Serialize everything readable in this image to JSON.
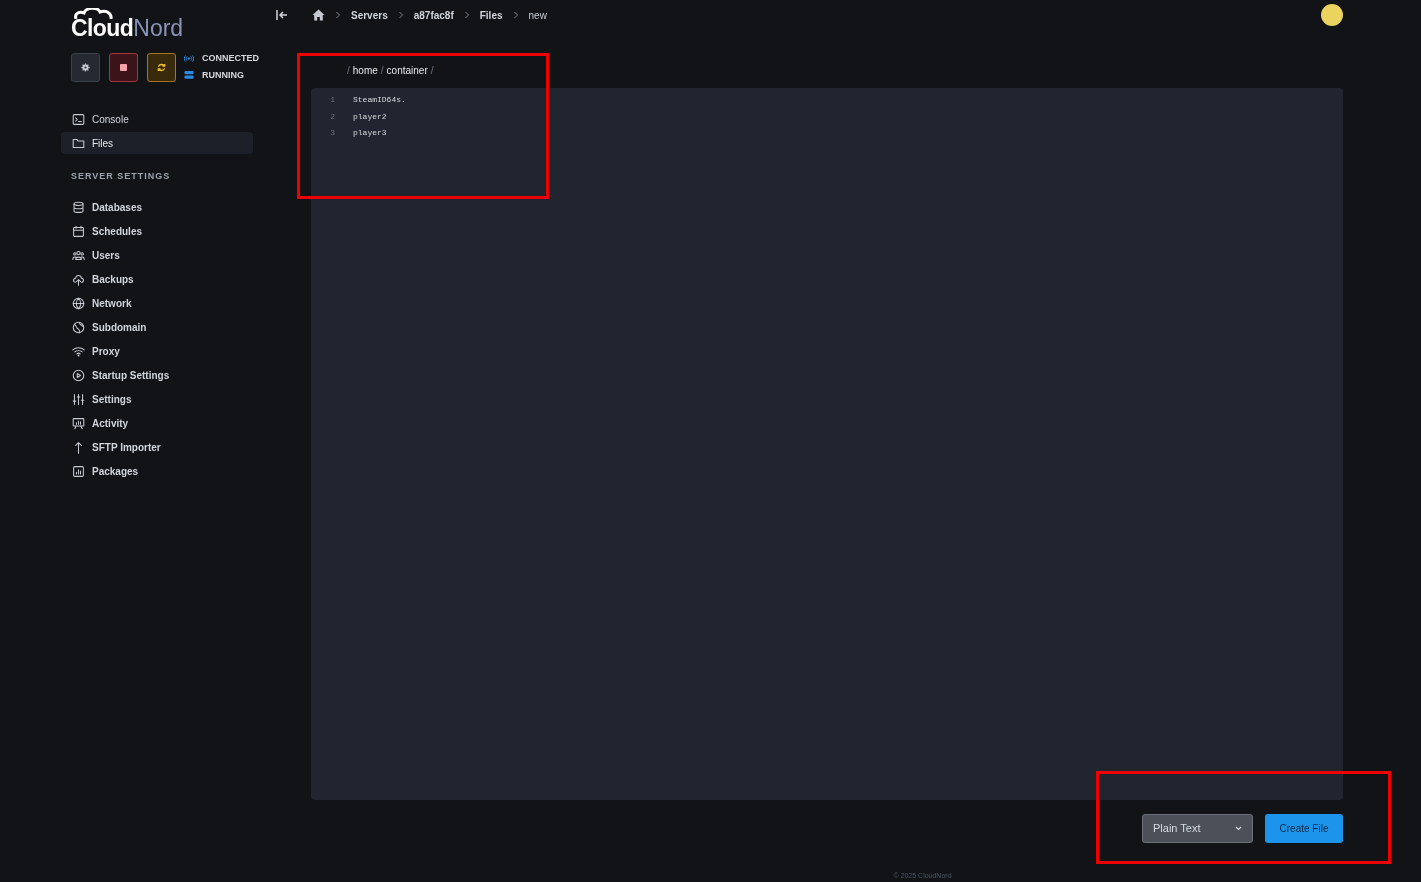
{
  "logo": {
    "bold": "Cloud",
    "light": "Nord"
  },
  "power_buttons": [
    {
      "kind": "settings"
    },
    {
      "kind": "stop"
    },
    {
      "kind": "restart"
    }
  ],
  "status": [
    {
      "kind": "connection",
      "label": "CONNECTED"
    },
    {
      "kind": "server",
      "label": "RUNNING"
    }
  ],
  "nav": [
    {
      "label": "Console",
      "selected": false
    },
    {
      "label": "Files",
      "selected": true
    }
  ],
  "settings_heading": "SERVER SETTINGS",
  "settings_nav": [
    {
      "label": "Databases"
    },
    {
      "label": "Schedules"
    },
    {
      "label": "Users"
    },
    {
      "label": "Backups"
    },
    {
      "label": "Network"
    },
    {
      "label": "Subdomain"
    },
    {
      "label": "Proxy"
    },
    {
      "label": "Startup Settings"
    },
    {
      "label": "Settings"
    },
    {
      "label": "Activity"
    },
    {
      "label": "SFTP Importer"
    },
    {
      "label": "Packages"
    }
  ],
  "breadcrumb": [
    "Servers",
    "a87fac8f",
    "Files",
    "new"
  ],
  "path": [
    {
      "kind": "separator",
      "text": "/"
    },
    {
      "kind": "folder",
      "text": "home"
    },
    {
      "kind": "separator",
      "text": "/"
    },
    {
      "kind": "folder",
      "text": "container"
    },
    {
      "kind": "separator",
      "text": "/"
    }
  ],
  "editor_lines": [
    {
      "number": "1",
      "text": "SteamID64s."
    },
    {
      "number": "2",
      "text": "player2"
    },
    {
      "number": "3",
      "text": "player3"
    }
  ],
  "file_type": "Plain Text",
  "create_button": "Create File",
  "footer": "© 2025 CloudNord"
}
